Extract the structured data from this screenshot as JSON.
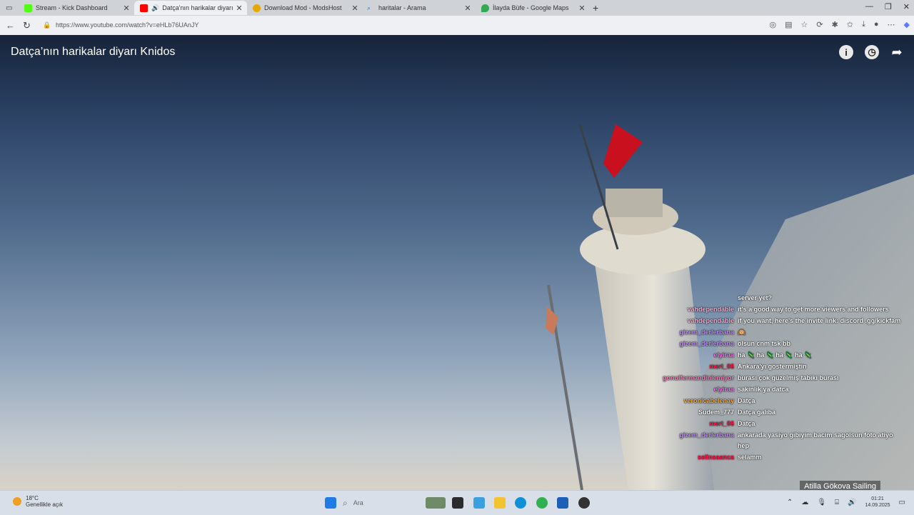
{
  "browser": {
    "tabs": [
      {
        "label": "Stream - Kick Dashboard",
        "icon": "kick-icon",
        "color": "#53fc18"
      },
      {
        "label": "Datça'nın harikalar diyarı Kn",
        "icon": "youtube-icon",
        "color": "#ff0000",
        "active": true
      },
      {
        "label": "Download Mod - ModsHost",
        "icon": "modshost-icon",
        "color": "#e8a800"
      },
      {
        "label": "haritalar - Arama",
        "icon": "bing-search-icon",
        "color": "#1a73e8"
      },
      {
        "label": "İlayda Büfe - Google Maps",
        "icon": "maps-icon",
        "color": "#34a853"
      }
    ],
    "new_tab_symbol": "+",
    "url": "https://www.youtube.com/watch?v=eHLb76UAnJY"
  },
  "video": {
    "title": "Datça’nın harikalar diyarı Knidos",
    "icons": [
      "info-icon",
      "clock-icon",
      "share-icon"
    ]
  },
  "chat": {
    "messages": [
      {
        "user": "",
        "text": "server yet?",
        "color": "#ffffff"
      },
      {
        "user": "vahdependable",
        "text": "it's a good way to get more viewers and followers",
        "color": "#ffb0d8"
      },
      {
        "user": "vahdependable",
        "text": "if you want, here's the invite link: discord .gg/kickfam",
        "color": "#ffb0d8"
      },
      {
        "user": "gizem_derlerbana",
        "text": "🙉",
        "color": "#c890ff"
      },
      {
        "user": "gizem_derlerbana",
        "text": "olsun cnm tsk bb",
        "color": "#c890ff"
      },
      {
        "user": "elyiraa",
        "text": "ha 🦎 ha 🦎 ha 🦎 ha 🦎",
        "color": "#ff70ff"
      },
      {
        "user": "mert_06",
        "text": "Ankara'yı göstermiştin",
        "color": "#ff2050"
      },
      {
        "user": "gonulfermandinlemiyor",
        "text": "burası çok güzelmiş tabiki burası",
        "color": "#ff80c0"
      },
      {
        "user": "elyiraa",
        "text": "sakinlik ya datca",
        "color": "#ff70ff"
      },
      {
        "user": "veronicabelenay",
        "text": "Datça",
        "color": "#ffb040"
      },
      {
        "user": "Sudem_777",
        "text": "Datça galiba",
        "color": "#ffffff"
      },
      {
        "user": "mert_06",
        "text": "Datça",
        "color": "#ff2050"
      },
      {
        "user": "gizem_derlerbana",
        "text": "ankarada yasiyo gibiyim bacim sagolsun foto atiyo hep",
        "color": "#c890ff"
      },
      {
        "user": "selinsaanca",
        "text": "selamm",
        "color": "#ff2050"
      }
    ],
    "channel_label": "Atilla Gökova Sailing"
  },
  "taskbar": {
    "weather_temp": "18°C",
    "weather_desc": "Genellikle açık",
    "search_placeholder": "Ara",
    "time": "01:21",
    "date": "14.09.2025"
  }
}
